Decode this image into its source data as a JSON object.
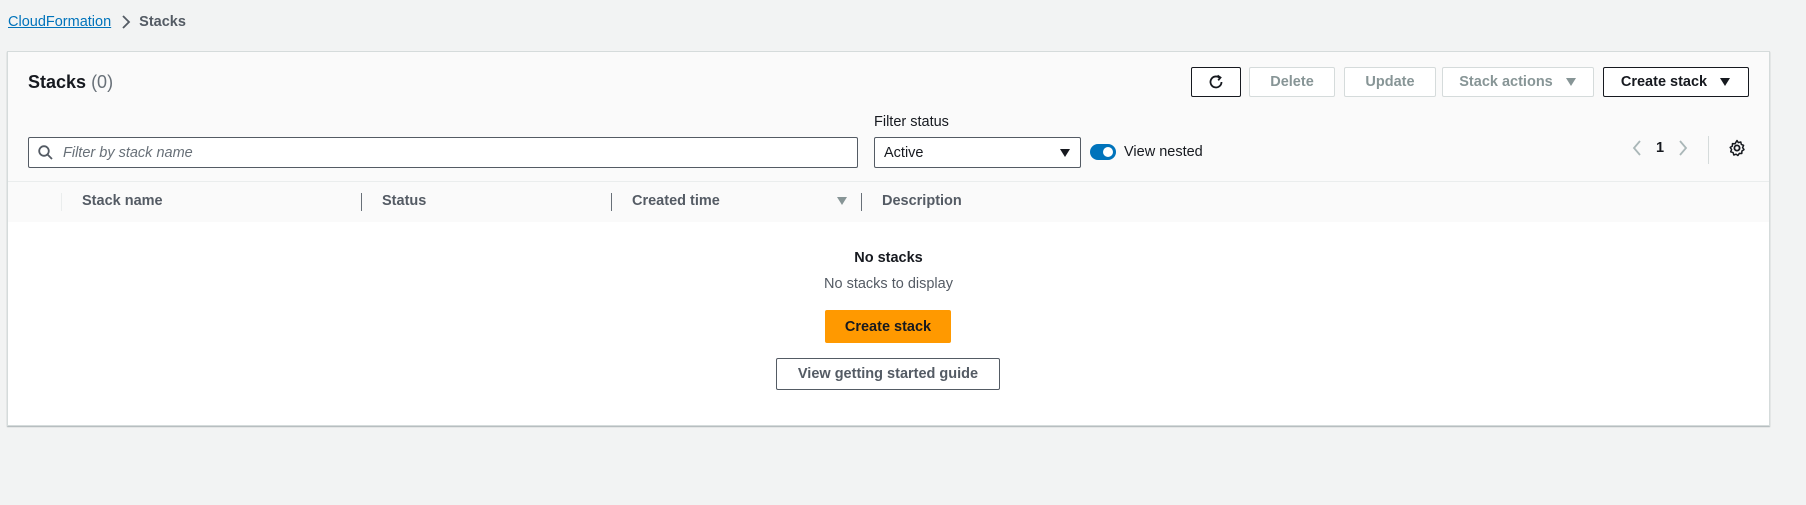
{
  "breadcrumb": {
    "parent": "CloudFormation",
    "current": "Stacks"
  },
  "panel": {
    "title": "Stacks",
    "count": "(0)"
  },
  "toolbar": {
    "refresh_icon": "refresh-icon",
    "delete_label": "Delete",
    "update_label": "Update",
    "stack_actions_label": "Stack actions",
    "create_stack_label": "Create stack"
  },
  "filters": {
    "search_placeholder": "Filter by stack name",
    "search_value": "",
    "filter_status_label": "Filter status",
    "filter_status_value": "Active",
    "view_nested_label": "View nested",
    "view_nested_on": true
  },
  "pagination": {
    "current_page": "1"
  },
  "table": {
    "columns": [
      "Stack name",
      "Status",
      "Created time",
      "Description"
    ],
    "rows": []
  },
  "empty_state": {
    "title": "No stacks",
    "subtitle": "No stacks to display",
    "primary_button": "Create stack",
    "secondary_button": "View getting started guide"
  },
  "colors": {
    "accent": "#0073bb",
    "primary_button": "#ff9900",
    "page_background": "#f2f3f3"
  }
}
